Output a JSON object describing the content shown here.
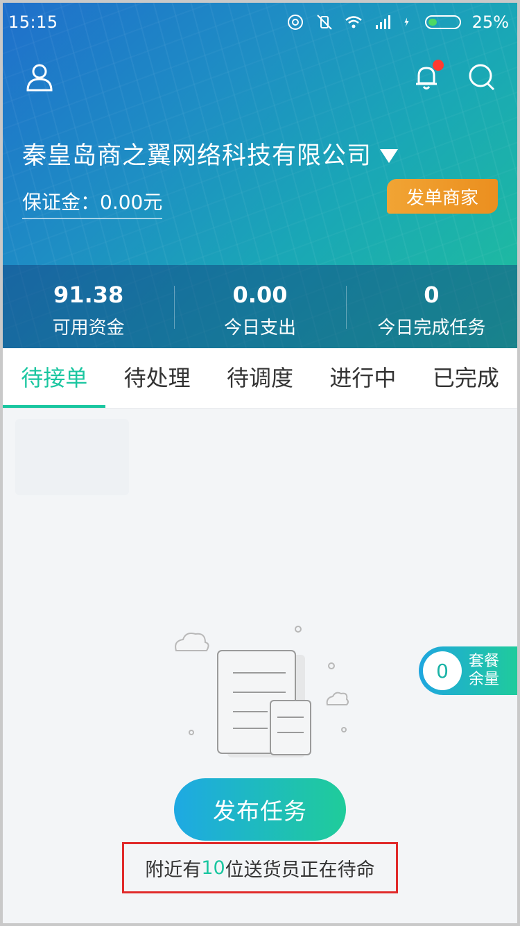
{
  "status_bar": {
    "time": "15:15",
    "battery": "25%",
    "icons": [
      "hotspot-icon",
      "vibrate-off-icon",
      "wifi-icon",
      "signal-icon",
      "charging-icon",
      "battery-icon"
    ]
  },
  "header": {
    "company_name": "秦皇岛商之翼网络科技有限公司",
    "deposit_label": "保证金：0.00元",
    "merchant_button": "发单商家",
    "icons": [
      "profile-icon",
      "bell-icon",
      "search-icon"
    ]
  },
  "stats": [
    {
      "value": "91.38",
      "label": "可用资金"
    },
    {
      "value": "0.00",
      "label": "今日支出"
    },
    {
      "value": "0",
      "label": "今日完成任务"
    }
  ],
  "tabs": [
    {
      "label": "待接单",
      "active": true
    },
    {
      "label": "待处理",
      "active": false
    },
    {
      "label": "待调度",
      "active": false
    },
    {
      "label": "进行中",
      "active": false
    },
    {
      "label": "已完成",
      "active": false
    }
  ],
  "main": {
    "publish_button": "发布任务",
    "nearby_prefix": "附近有",
    "nearby_count": "10",
    "nearby_suffix": "位送货员正在待命"
  },
  "package_widget": {
    "count": "0",
    "line1": "套餐",
    "line2": "余量"
  },
  "colors": {
    "accent": "#1ac6a0",
    "header_start": "#1f6fcb",
    "header_end": "#1fbf9b",
    "merchant_orange": "#eb8f1f",
    "highlight_border": "#e02a2a"
  }
}
